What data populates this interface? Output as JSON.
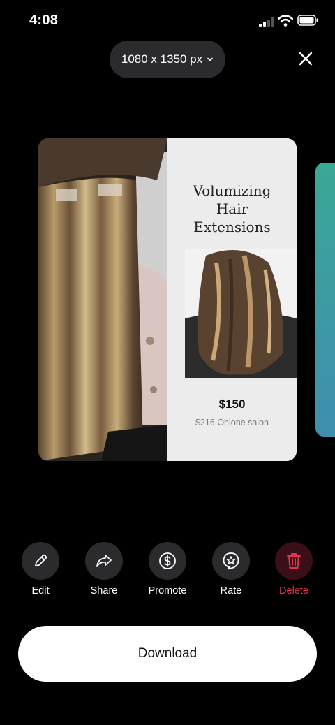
{
  "status_bar": {
    "time": "4:08"
  },
  "header": {
    "size_label": "1080 x 1350 px",
    "size_icon": "chevron-down-icon",
    "close_icon": "close-icon"
  },
  "card": {
    "title_lines": [
      "Volumizing",
      "Hair",
      "Extensions"
    ],
    "price": "$150",
    "old_price": "$216",
    "salon": "Ohlone salon"
  },
  "actions": [
    {
      "label": "Edit",
      "icon": "pencil-icon"
    },
    {
      "label": "Share",
      "icon": "share-arrow-icon"
    },
    {
      "label": "Promote",
      "icon": "dollar-icon"
    },
    {
      "label": "Rate",
      "icon": "star-badge-icon"
    },
    {
      "label": "Delete",
      "icon": "trash-icon"
    }
  ],
  "download_label": "Download",
  "colors": {
    "delete": "#e0344f",
    "pill_bg": "#2b2b2d",
    "card_panel": "#ececec"
  }
}
